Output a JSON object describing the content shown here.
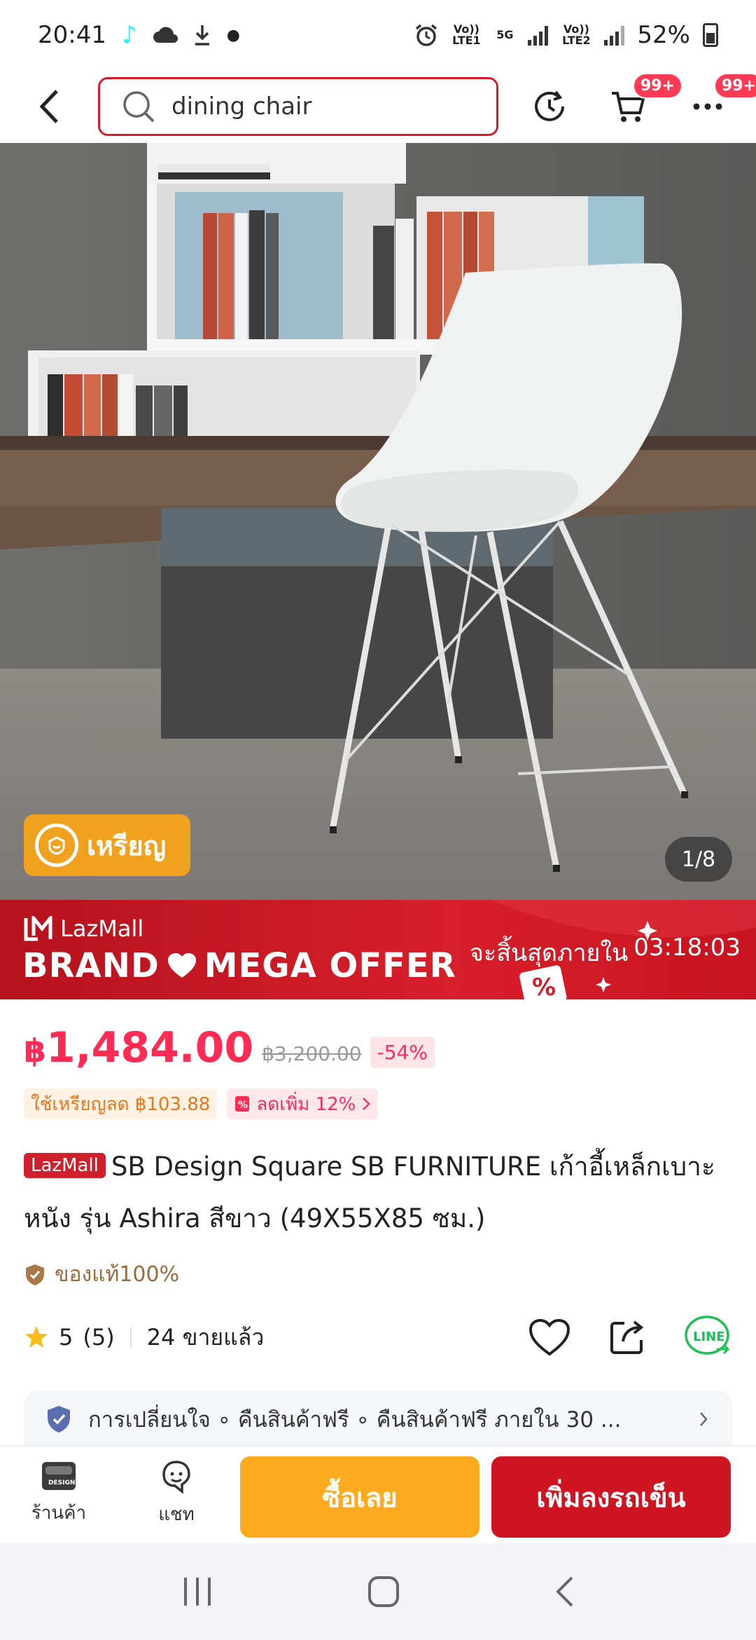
{
  "status_bar": {
    "time": "20:41",
    "net1": "Vo)) LTE1",
    "net2": "5G",
    "net3": "Vo)) LTE2",
    "battery": "52%"
  },
  "search": {
    "query": "dining chair"
  },
  "nav": {
    "cart_badge": "99+",
    "more_badge": "99+"
  },
  "gallery": {
    "coin_label": "เหรียญ",
    "page_indicator": "1/8"
  },
  "promo": {
    "brand": "LazMall",
    "title_left": "BRAND",
    "title_right": "MEGA OFFER",
    "countdown_label": "จะสิ้นสุดภายใน",
    "countdown_time": "03:18:03"
  },
  "product": {
    "price": "1,484.00",
    "currency": "฿",
    "original_price": "฿3,200.00",
    "discount": "-54%",
    "coin_discount": "ใช้เหรียญลด ฿103.88",
    "extra_discount": "ลดเพิ่ม 12%",
    "mall_tag": "LazMall",
    "title": "SB Design Square SB FURNITURE เก้าอี้เหล็กเบาะหนัง รุ่น Ashira สีขาว (49X55X85 ซม.)",
    "authentic": "ของแท้100%",
    "rating": "5",
    "review_count": "(5)",
    "sold": "24 ขายแล้ว"
  },
  "service": {
    "text": "การเปลี่ยนใจ ∘ คืนสินค้าฟรี ∘ คืนสินค้าฟรี ภายใน 30 ..."
  },
  "action_bar": {
    "shop_label": "ร้านค้า",
    "chat_label": "แชท",
    "buy_now": "ซื้อเลย",
    "add_to_cart": "เพิ่มลงรถเข็น"
  },
  "colors": {
    "accent_red": "#d61c2a",
    "price_pink": "#fe2c55",
    "buy_orange": "#fdaa1f",
    "cart_red": "#cf1422",
    "coin_orange": "#f0a21e"
  },
  "icons": [
    "back-icon",
    "search-icon",
    "history-icon",
    "cart-icon",
    "more-icon",
    "coin-icon",
    "heart-icon",
    "share-icon",
    "line-icon",
    "shield-check-icon",
    "star-icon",
    "chevron-right-icon",
    "shop-icon",
    "chat-icon"
  ]
}
